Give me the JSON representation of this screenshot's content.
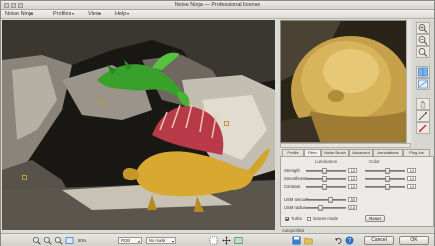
{
  "window": {
    "title": "Noise Ninja — Professional license"
  },
  "menu": {
    "items": [
      "Noise Ninja",
      "Profiles",
      "View",
      "Help"
    ]
  },
  "tabs": [
    "Profile",
    "Filter",
    "Noise Brush",
    "Advanced",
    "Annotations",
    "Plug-ins"
  ],
  "active_tab_index": 1,
  "panel": {
    "luminance_label": "Luminance",
    "color_label": "Color",
    "rows": [
      {
        "label": "Strength",
        "lum_value": "10",
        "col_value": "10"
      },
      {
        "label": "Smoothness",
        "lum_value": "10",
        "col_value": "10"
      },
      {
        "label": "Contrast",
        "lum_value": "10",
        "col_value": "10"
      },
      {
        "label": "USM amount",
        "lum_value": "50",
        "col_value": ""
      },
      {
        "label": "USM radius",
        "lum_value": "0.8",
        "col_value": ""
      }
    ],
    "turbo_label": "Turbo",
    "turbo_checked": true,
    "screen_mode_label": "Screen mode",
    "screen_mode_checked": false,
    "reset_label": "Reset"
  },
  "autoprofile_label": "Autoprofiled",
  "status": {
    "zoom_percent": "50%",
    "dropdown_1": "RGB",
    "dropdown_2": "No mask",
    "ok_label": "OK",
    "cancel_label": "Cancel",
    "help_label": "?"
  },
  "colors": {
    "accent_blue": "#2b6fc4",
    "toolbar_red": "#c62d2d"
  },
  "icons": [
    "zoom-in-icon",
    "zoom-out-icon",
    "fit-icon",
    "hand-icon",
    "eyedropper-icon",
    "brush-icon",
    "save-icon",
    "open-icon",
    "undo-icon",
    "help-icon"
  ]
}
